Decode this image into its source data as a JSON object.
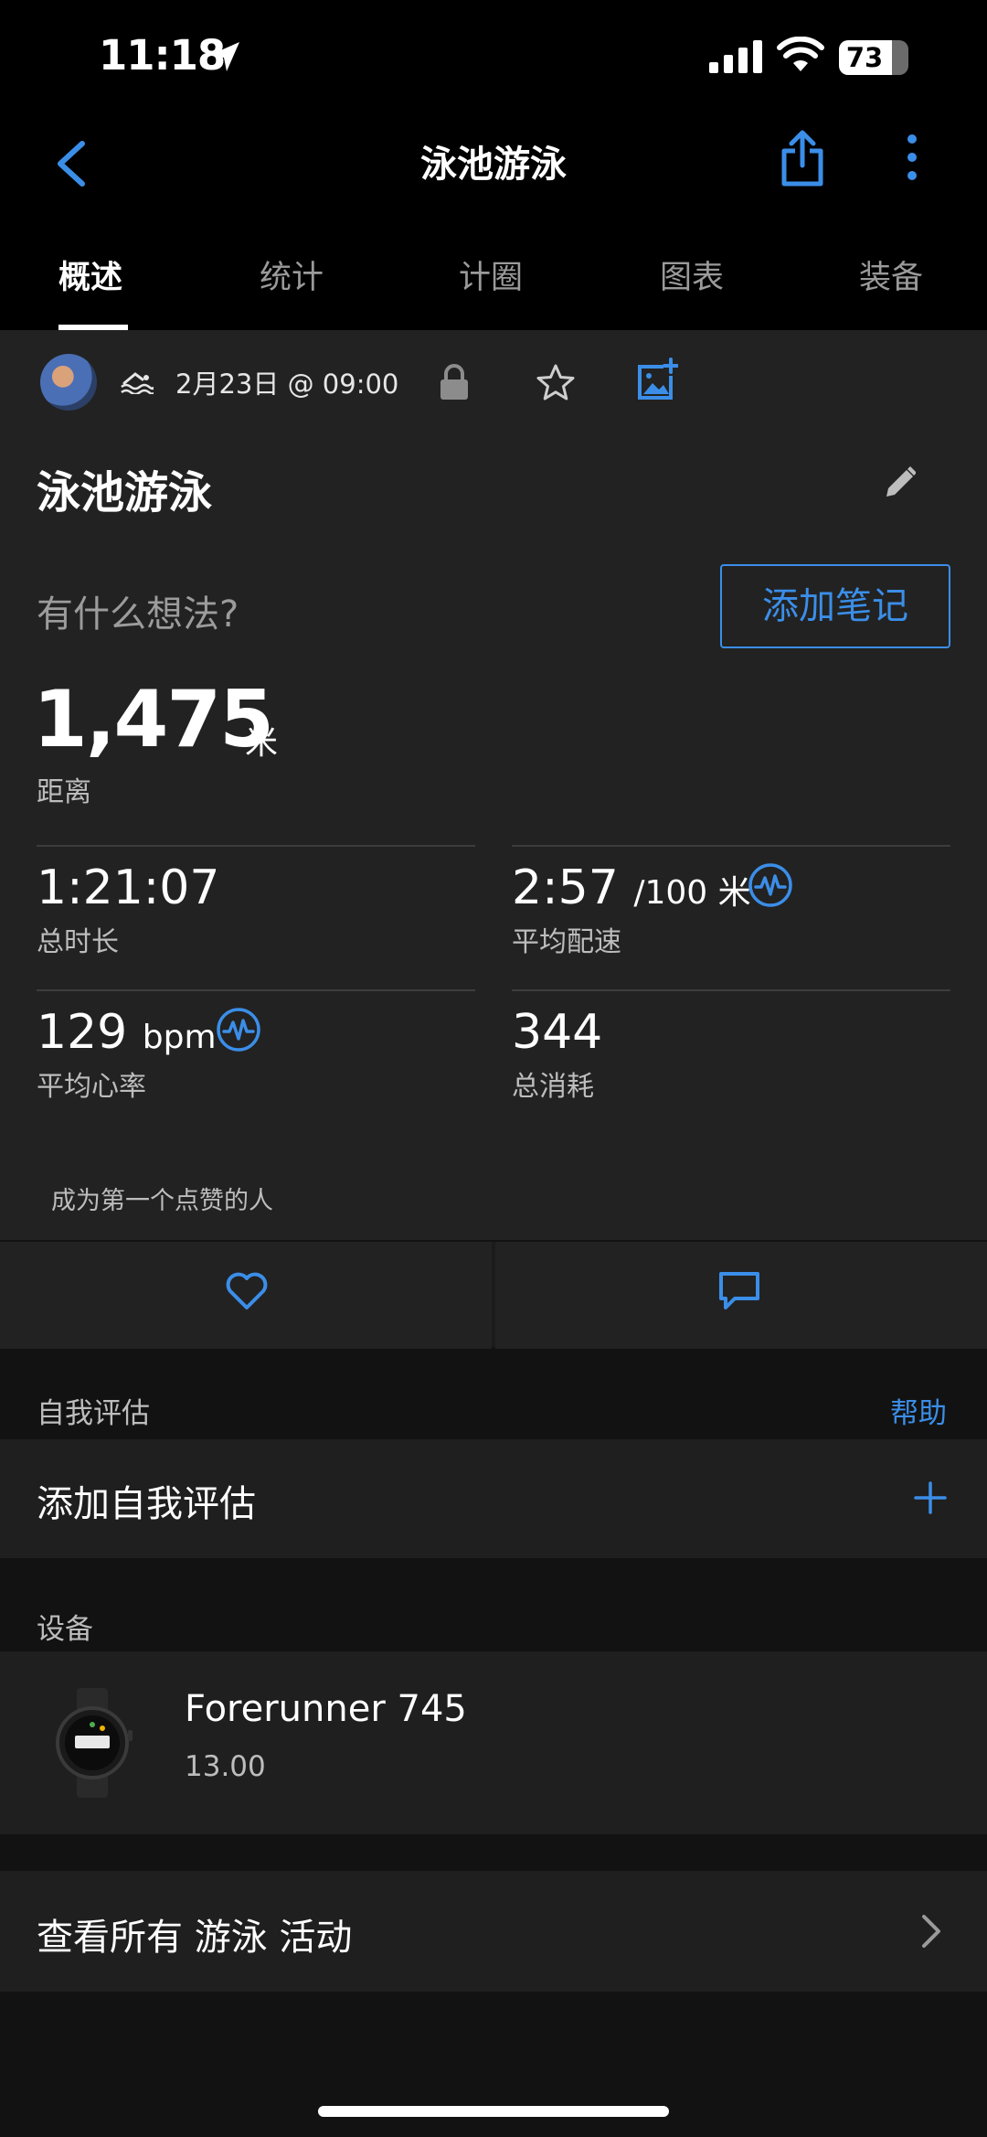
{
  "status_bar": {
    "time": "11:18",
    "battery": "73"
  },
  "header": {
    "title": "泳池游泳",
    "back_icon": "chevron-left-icon",
    "share_icon": "share-icon",
    "more_icon": "more-vertical-icon",
    "accent_color": "#3b8ee8"
  },
  "tabs": [
    {
      "label": "概述",
      "active": true
    },
    {
      "label": "统计",
      "active": false
    },
    {
      "label": "计圈",
      "active": false
    },
    {
      "label": "图表",
      "active": false
    },
    {
      "label": "装备",
      "active": false
    }
  ],
  "activity": {
    "date": "2月23日 @ 09:00",
    "title": "泳池游泳",
    "thought_prompt": "有什么想法?",
    "add_note_label": "添加笔记",
    "distance": {
      "value": "1,475",
      "unit": "米",
      "label": "距离"
    },
    "duration": {
      "value": "1:21:07",
      "label": "总时长"
    },
    "pace": {
      "value": "2:57",
      "unit": "/100 米",
      "label": "平均配速"
    },
    "heart_rate": {
      "value": "129",
      "unit": "bpm",
      "label": "平均心率"
    },
    "calories": {
      "value": "344",
      "label": "总消耗"
    },
    "first_like": "成为第一个点赞的人"
  },
  "self_assessment": {
    "section_label": "自我评估",
    "help_label": "帮助",
    "add_label": "添加自我评估"
  },
  "device": {
    "section_label": "设备",
    "name": "Forerunner 745",
    "version": "13.00"
  },
  "view_all": {
    "label": "查看所有 游泳 活动"
  }
}
